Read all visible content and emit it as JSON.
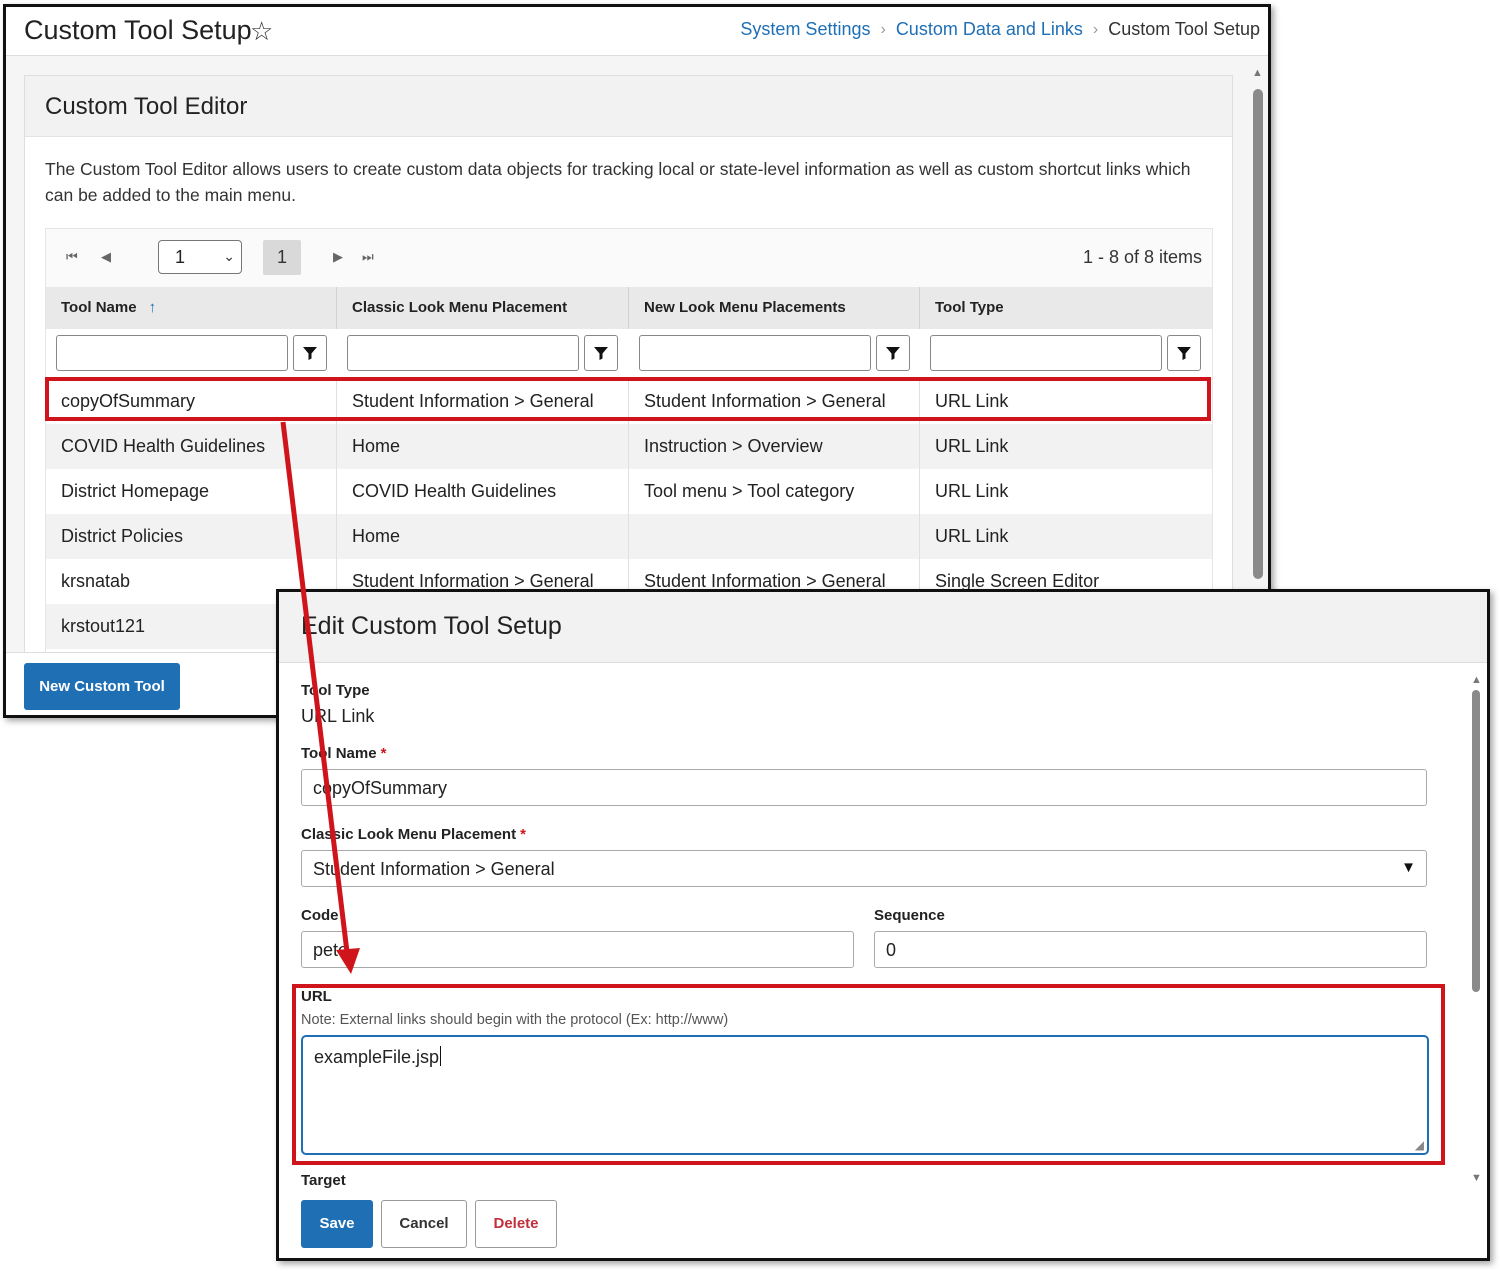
{
  "page": {
    "title": "Custom Tool Setup",
    "breadcrumbs": [
      "System Settings",
      "Custom Data and Links",
      "Custom Tool Setup"
    ]
  },
  "editor": {
    "title": "Custom Tool Editor",
    "description": "The Custom Tool Editor allows users to create custom data objects for tracking local or state-level information as well as custom shortcut links which can be added to the main menu.",
    "pager": {
      "page_select": "1",
      "current_page": "1",
      "info": "1 - 8 of 8 items"
    },
    "columns": [
      "Tool Name",
      "Classic Look Menu Placement",
      "New Look Menu Placements",
      "Tool Type"
    ],
    "rows": [
      [
        "copyOfSummary",
        "Student Information > General",
        "Student Information > General",
        "URL Link"
      ],
      [
        "COVID Health Guidelines",
        "Home",
        "Instruction > Overview",
        "URL Link"
      ],
      [
        "District Homepage",
        "COVID Health Guidelines",
        "Tool menu > Tool category",
        "URL Link"
      ],
      [
        "District Policies",
        "Home",
        "",
        "URL Link"
      ],
      [
        "krsnatab",
        "Student Information > General",
        "Student Information > General",
        "Single Screen Editor"
      ],
      [
        "krstout121",
        "",
        "",
        ""
      ]
    ],
    "new_button": "New Custom Tool"
  },
  "modal": {
    "title": "Edit Custom Tool Setup",
    "tool_type_label": "Tool Type",
    "tool_type_value": "URL Link",
    "tool_name_label": "Tool Name",
    "tool_name_value": "copyOfSummary",
    "classic_label": "Classic Look Menu Placement",
    "classic_value": "Student Information > General",
    "code_label": "Code",
    "code_value": "pete",
    "sequence_label": "Sequence",
    "sequence_value": "0",
    "url_label": "URL",
    "url_note": "Note: External links should begin with the protocol (Ex: http://www)",
    "url_value": "exampleFile.jsp",
    "target_label": "Target",
    "required_mark": "*",
    "buttons": {
      "save": "Save",
      "cancel": "Cancel",
      "delete": "Delete"
    }
  },
  "colors": {
    "accent": "#1f6fb5",
    "highlight": "#d0141b",
    "delete_text": "#c0303a"
  },
  "icons": [
    "star-icon",
    "chevron-right-icon",
    "first-page-icon",
    "prev-page-icon",
    "next-page-icon",
    "last-page-icon",
    "sort-ascending-icon",
    "filter-icon",
    "dropdown-arrow-icon",
    "resize-handle-icon"
  ]
}
